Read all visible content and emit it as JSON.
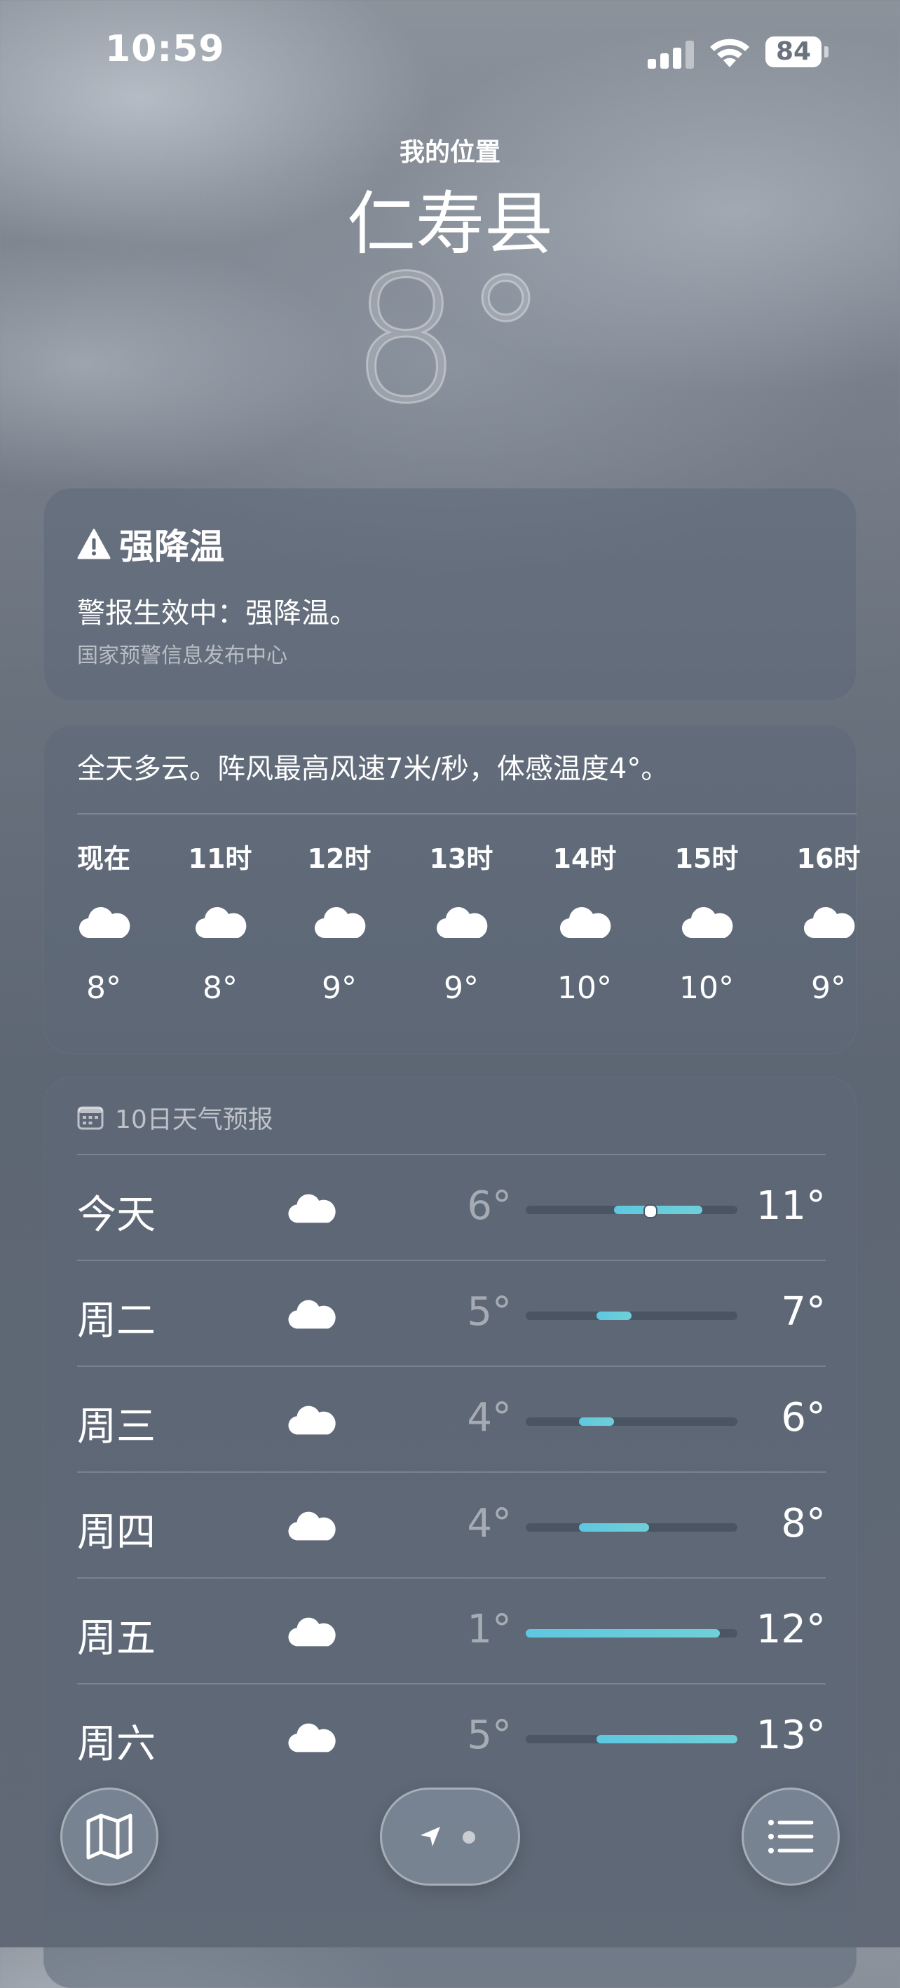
{
  "status_bar": {
    "time": "10:59",
    "battery": "84"
  },
  "location": {
    "subtitle": "我的位置",
    "name": "仁寿县",
    "temperature": "8°"
  },
  "alert": {
    "title": "强降温",
    "text": "警报生效中：强降温。",
    "source": "国家预警信息发布中心",
    "icon": "warning-triangle-icon"
  },
  "hourly": {
    "summary": "全天多云。阵风最高风速7米/秒，体感温度4°。",
    "items": [
      {
        "label": "现在",
        "icon": "cloud-icon",
        "temp": "8°"
      },
      {
        "label": "11时",
        "icon": "cloud-icon",
        "temp": "8°"
      },
      {
        "label": "12时",
        "icon": "cloud-icon",
        "temp": "9°"
      },
      {
        "label": "13时",
        "icon": "cloud-icon",
        "temp": "9°"
      },
      {
        "label": "14时",
        "icon": "cloud-icon",
        "temp": "10°"
      },
      {
        "label": "15时",
        "icon": "cloud-icon",
        "temp": "10°"
      },
      {
        "label": "16时",
        "icon": "cloud-icon",
        "temp": "9°"
      }
    ]
  },
  "daily": {
    "title": "10日天气预报",
    "range_min": 1,
    "range_max": 13,
    "days": [
      {
        "name": "今天",
        "icon": "cloud-icon",
        "low": "6°",
        "high": "11°",
        "low_val": 6,
        "high_val": 11,
        "current_val": 8
      },
      {
        "name": "周二",
        "icon": "cloud-icon",
        "low": "5°",
        "high": "7°",
        "low_val": 5,
        "high_val": 7
      },
      {
        "name": "周三",
        "icon": "cloud-icon",
        "low": "4°",
        "high": "6°",
        "low_val": 4,
        "high_val": 6
      },
      {
        "name": "周四",
        "icon": "cloud-icon",
        "low": "4°",
        "high": "8°",
        "low_val": 4,
        "high_val": 8
      },
      {
        "name": "周五",
        "icon": "cloud-icon",
        "low": "1°",
        "high": "12°",
        "low_val": 1,
        "high_val": 12
      },
      {
        "name": "周六",
        "icon": "cloud-icon",
        "low": "5°",
        "high": "13°",
        "low_val": 5,
        "high_val": 13
      }
    ]
  },
  "toolbar": {
    "map_icon": "map-icon",
    "location_icon": "location-arrow-icon",
    "list_icon": "list-icon"
  },
  "colors": {
    "temp_bar": "#5ec8e0",
    "card_bg": "#5c6878"
  }
}
